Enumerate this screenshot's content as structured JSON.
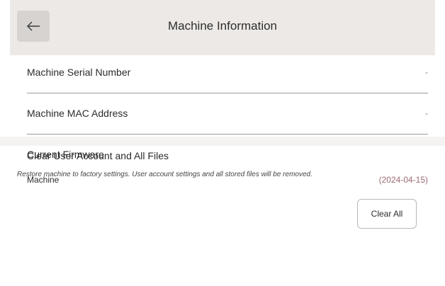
{
  "header": {
    "back_icon": "arrow-left-icon",
    "title": "Machine Information"
  },
  "info_rows": [
    {
      "label": "Machine Serial Number",
      "value": "-"
    },
    {
      "label": "Machine MAC Address",
      "value": "-"
    }
  ],
  "firmware": {
    "section_label": "Current Firmware",
    "item_label": "Machine",
    "item_value": "(2024-04-15)"
  },
  "reset": {
    "title": "Clear User Account and All Files",
    "description": "Restore machine to factory settings. User account settings and all stored files will be removed.",
    "button_label": "Clear All"
  },
  "colors": {
    "header_bg": "#ede9e6",
    "back_button_bg": "#d7d3d1",
    "firmware_value": "#9c6a72",
    "divider": "#9a9a9a"
  }
}
